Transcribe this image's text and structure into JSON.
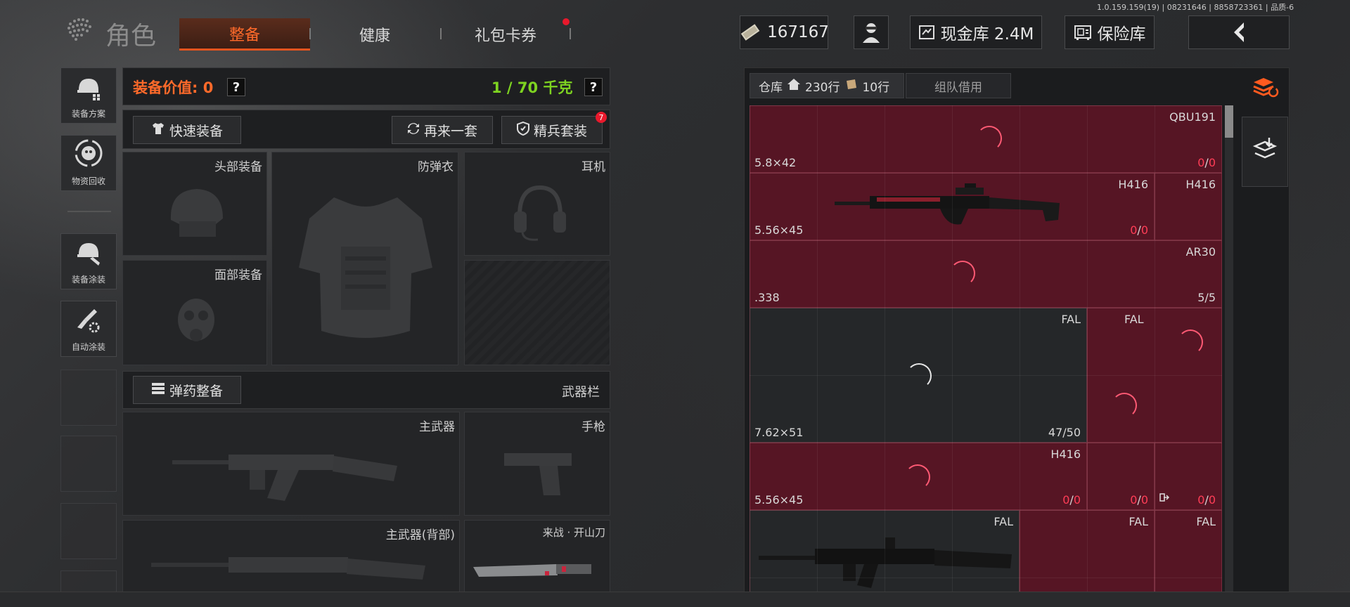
{
  "version": "1.0.159.159(19) | 08231646 | 8858723361 | 品质-6",
  "title": "角色",
  "tabs": [
    {
      "label": "整备",
      "active": true
    },
    {
      "label": "健康",
      "active": false
    },
    {
      "label": "礼包卡券",
      "active": false,
      "badge_dot": true
    }
  ],
  "top": {
    "currency_value": "167167",
    "cash_label": "现金库 2.4M",
    "safe_label": "保险库",
    "back_icon": "chevron-left-icon"
  },
  "left_tools": [
    {
      "label": "装备方案",
      "icon": "helmet-plan-icon"
    },
    {
      "label": "物资回收",
      "icon": "recycle-icon"
    },
    {
      "label": "装备涂装",
      "icon": "helmet-paint-icon"
    },
    {
      "label": "自动涂装",
      "icon": "brush-gear-icon"
    }
  ],
  "equip": {
    "value_label": "装备价值: 0",
    "weight_label": "1 / 70 千克",
    "quick_equip": "快速装备",
    "again": "再来一套",
    "elite": "精兵套装",
    "elite_badge": "7",
    "slots": {
      "head": "头部装备",
      "armor": "防弹衣",
      "headset": "耳机",
      "face": "面部装备"
    },
    "ammo_btn": "弹药整备",
    "weapon_bar": "武器栏",
    "weapons": {
      "primary": "主武器",
      "pistol": "手枪",
      "primary_back": "主武器(背部)",
      "melee": "来战 · 开山刀"
    }
  },
  "storage": {
    "tab_storage": "仓库",
    "rows_home": "230行",
    "rows_bag": "10行",
    "tab_team": "组队借用",
    "items": {
      "r1_name": "QBU191",
      "r1_cal": "5.8×42",
      "r1_cnt_a": "0",
      "r1_cnt_b": "0",
      "r2_name_a": "H416",
      "r2_name_b": "H416",
      "r2_cal": "5.56×45",
      "r2_cnt_a": "0",
      "r2_cnt_b": "0",
      "r3_name": "AR30",
      "r3_cal": ".338",
      "r3_cnt": "5/5",
      "r4_name_a": "FAL",
      "r4_name_b": "FAL",
      "r4_cal": "7.62×51",
      "r4_cnt": "47/50",
      "r5_name": "H416",
      "r5_cal": "5.56×45",
      "r5_cnt_a_1": "0",
      "r5_cnt_a_2": "0",
      "r5_cnt_b_1": "0",
      "r5_cnt_b_2": "0",
      "r5_cnt_c_1": "0",
      "r5_cnt_c_2": "0",
      "r6_name_a": "FAL",
      "r6_name_b": "FAL",
      "r6_name_c": "FAL"
    }
  },
  "colors": {
    "accent": "#ff6a2a",
    "weight_green": "#7ed321",
    "cell_red": "#5f1426",
    "count_red": "#ff3d56"
  }
}
